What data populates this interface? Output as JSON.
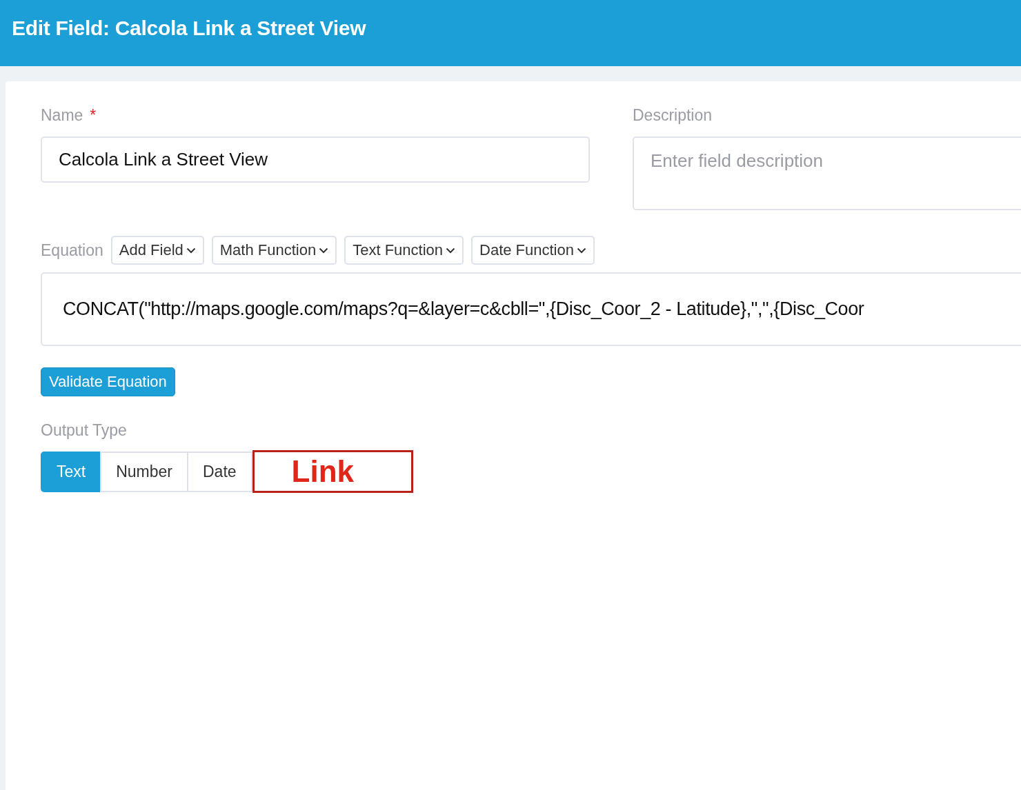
{
  "header": {
    "title": "Edit Field: Calcola Link a Street View"
  },
  "name": {
    "label": "Name",
    "required_mark": "*",
    "value": "Calcola Link a Street View"
  },
  "description": {
    "label": "Description",
    "placeholder": "Enter field description"
  },
  "equation": {
    "label": "Equation",
    "menus": [
      "Add Field",
      "Math Function",
      "Text Function",
      "Date Function"
    ],
    "value": "CONCAT(\"http://maps.google.com/maps?q=&layer=c&cbll=\",{Disc_Coor_2 - Latitude},\",\",{Disc_Coor"
  },
  "validate_button": "Validate Equation",
  "output_type": {
    "label": "Output Type",
    "options": [
      {
        "label": "Text",
        "kind": "segment",
        "selected": true
      },
      {
        "label": "Number",
        "kind": "segment",
        "selected": false
      },
      {
        "label": "Date",
        "kind": "segment",
        "selected": false
      },
      {
        "label": "Link",
        "kind": "annotation",
        "selected": false
      }
    ]
  }
}
